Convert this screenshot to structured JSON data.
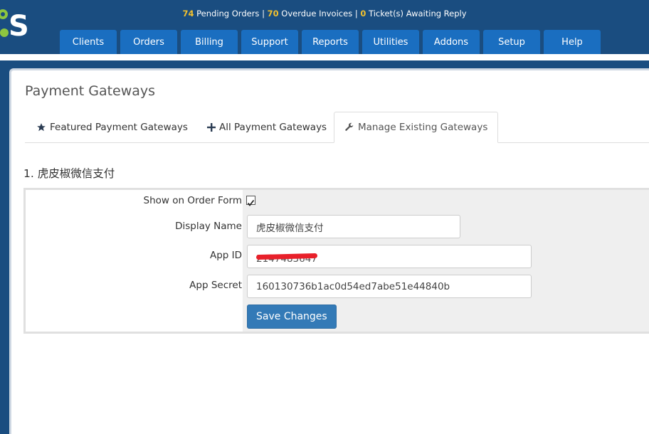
{
  "header": {
    "status": {
      "pending_orders_count": "74",
      "pending_orders_label": "Pending Orders",
      "overdue_invoices_count": "70",
      "overdue_invoices_label": "Overdue Invoices",
      "tickets_count": "0",
      "tickets_label": "Ticket(s) Awaiting Reply",
      "separator": "|"
    },
    "logo_letter": "S"
  },
  "nav": [
    "Clients",
    "Orders",
    "Billing",
    "Support",
    "Reports",
    "Utilities",
    "Addons",
    "Setup",
    "Help"
  ],
  "page": {
    "title": "Payment Gateways",
    "tabs": [
      {
        "label": "Featured Payment Gateways",
        "icon": "star-icon"
      },
      {
        "label": "All Payment Gateways",
        "icon": "plus-icon"
      },
      {
        "label": "Manage Existing Gateways",
        "icon": "wrench-icon"
      }
    ],
    "active_tab": 2
  },
  "gateway": {
    "title": "1. 虎皮椒微信支付",
    "fields": {
      "show_on_order_form_label": "Show on Order Form",
      "show_on_order_form_checked": true,
      "display_name_label": "Display Name",
      "display_name_value": "虎皮椒微信支付",
      "app_id_label": "App ID",
      "app_id_value": "2147483647",
      "app_secret_label": "App Secret",
      "app_secret_value": "160130736b1ac0d54ed7abe51e44840b"
    },
    "save_label": "Save Changes"
  },
  "colors": {
    "header_bg": "#1a4d80",
    "nav_tab_bg": "#1a6ec0",
    "count_highlight": "#f2c12e",
    "primary_button": "#337ab7",
    "redaction": "#e8202a"
  }
}
